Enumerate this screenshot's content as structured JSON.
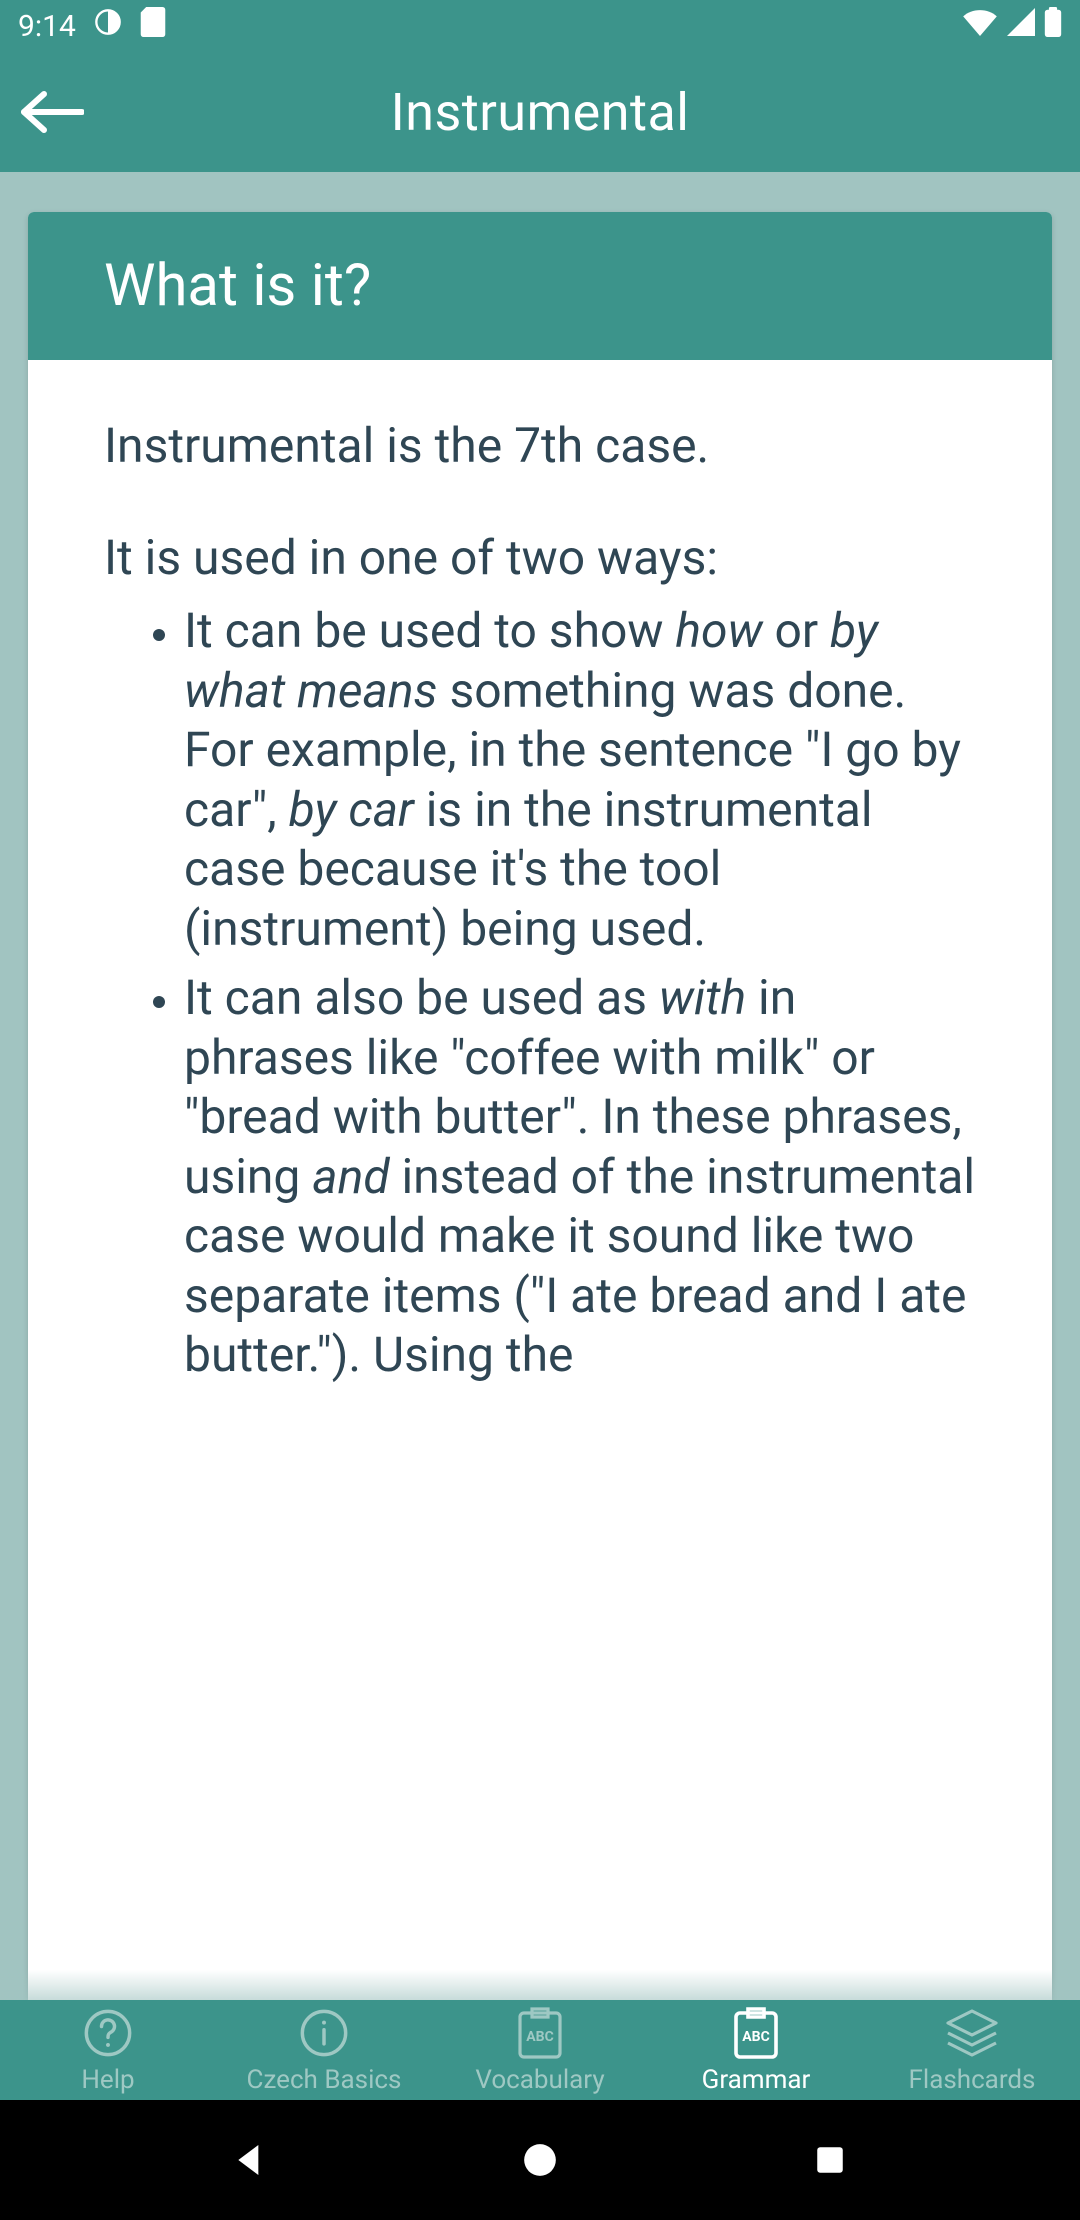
{
  "status": {
    "time": "9:14"
  },
  "header": {
    "title": "Instrumental"
  },
  "card": {
    "heading": "What is it?",
    "p1": "Instrumental is the 7th case.",
    "p2": "It is used in one of two ways:",
    "li1": {
      "a": "It can be used to show ",
      "how": "how",
      "b": " or ",
      "bywhat": "by what means",
      "c": " something was done. For example, in the sentence \"I go by car\", ",
      "bycar": "by car",
      "d": " is in the instrumental case because it's the tool (instrument) being used."
    },
    "li2": {
      "a": "It can also be used as ",
      "with": "with",
      "b": " in phrases like \"coffee with milk\" or \"bread with butter\". In these phrases, using ",
      "and": "and",
      "c": " instead of the instrumental case would make it sound like two separate items (\"I ate bread and I ate butter.\"). Using the"
    }
  },
  "nav": {
    "help": "Help",
    "basics": "Czech Basics",
    "vocab": "Vocabulary",
    "grammar": "Grammar",
    "flash": "Flashcards"
  },
  "icons": {
    "help": "help-circle-icon",
    "basics": "info-circle-icon",
    "vocab": "abc-book-icon",
    "grammar": "abc-book-icon",
    "flash": "stack-icon"
  },
  "colors": {
    "accent": "#3c948b",
    "bg": "#a1c4c1",
    "text": "#2f4654",
    "inactive": "#9ec8c3"
  }
}
